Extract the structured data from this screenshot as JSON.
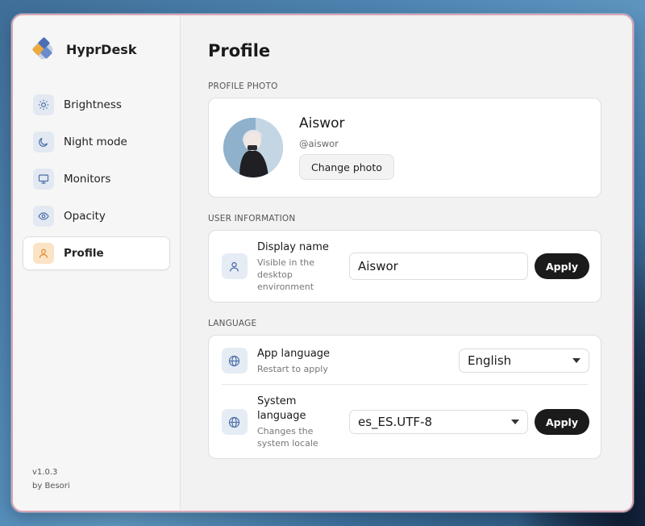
{
  "app": {
    "name": "HyprDesk",
    "version": "v1.0.3",
    "author": "by Besori"
  },
  "sidebar": {
    "items": [
      {
        "label": "Brightness",
        "icon": "sun-icon",
        "active": false
      },
      {
        "label": "Night mode",
        "icon": "moon-icon",
        "active": false
      },
      {
        "label": "Monitors",
        "icon": "monitor-icon",
        "active": false
      },
      {
        "label": "Opacity",
        "icon": "eye-icon",
        "active": false
      },
      {
        "label": "Profile",
        "icon": "user-icon",
        "active": true
      }
    ]
  },
  "page": {
    "title": "Profile"
  },
  "profile_photo": {
    "section_label": "PROFILE PHOTO",
    "name": "Aiswor",
    "handle": "@aiswor",
    "change_label": "Change photo"
  },
  "user_info": {
    "section_label": "USER INFORMATION",
    "display_name": {
      "title": "Display name",
      "subtitle": "Visible in the desktop environment",
      "value": "Aiswor",
      "apply_label": "Apply"
    }
  },
  "language": {
    "section_label": "LANGUAGE",
    "app_language": {
      "title": "App language",
      "subtitle": "Restart to apply",
      "selected": "English"
    },
    "system_language": {
      "title": "System language",
      "subtitle": "Changes the system locale",
      "selected": "es_ES.UTF-8",
      "apply_label": "Apply"
    }
  },
  "colors": {
    "accent_dark": "#1b1b1b",
    "icon_bg": "#e5ecf4",
    "active_icon_bg": "#fbe3c5",
    "window_border": "#d9a6b6"
  }
}
